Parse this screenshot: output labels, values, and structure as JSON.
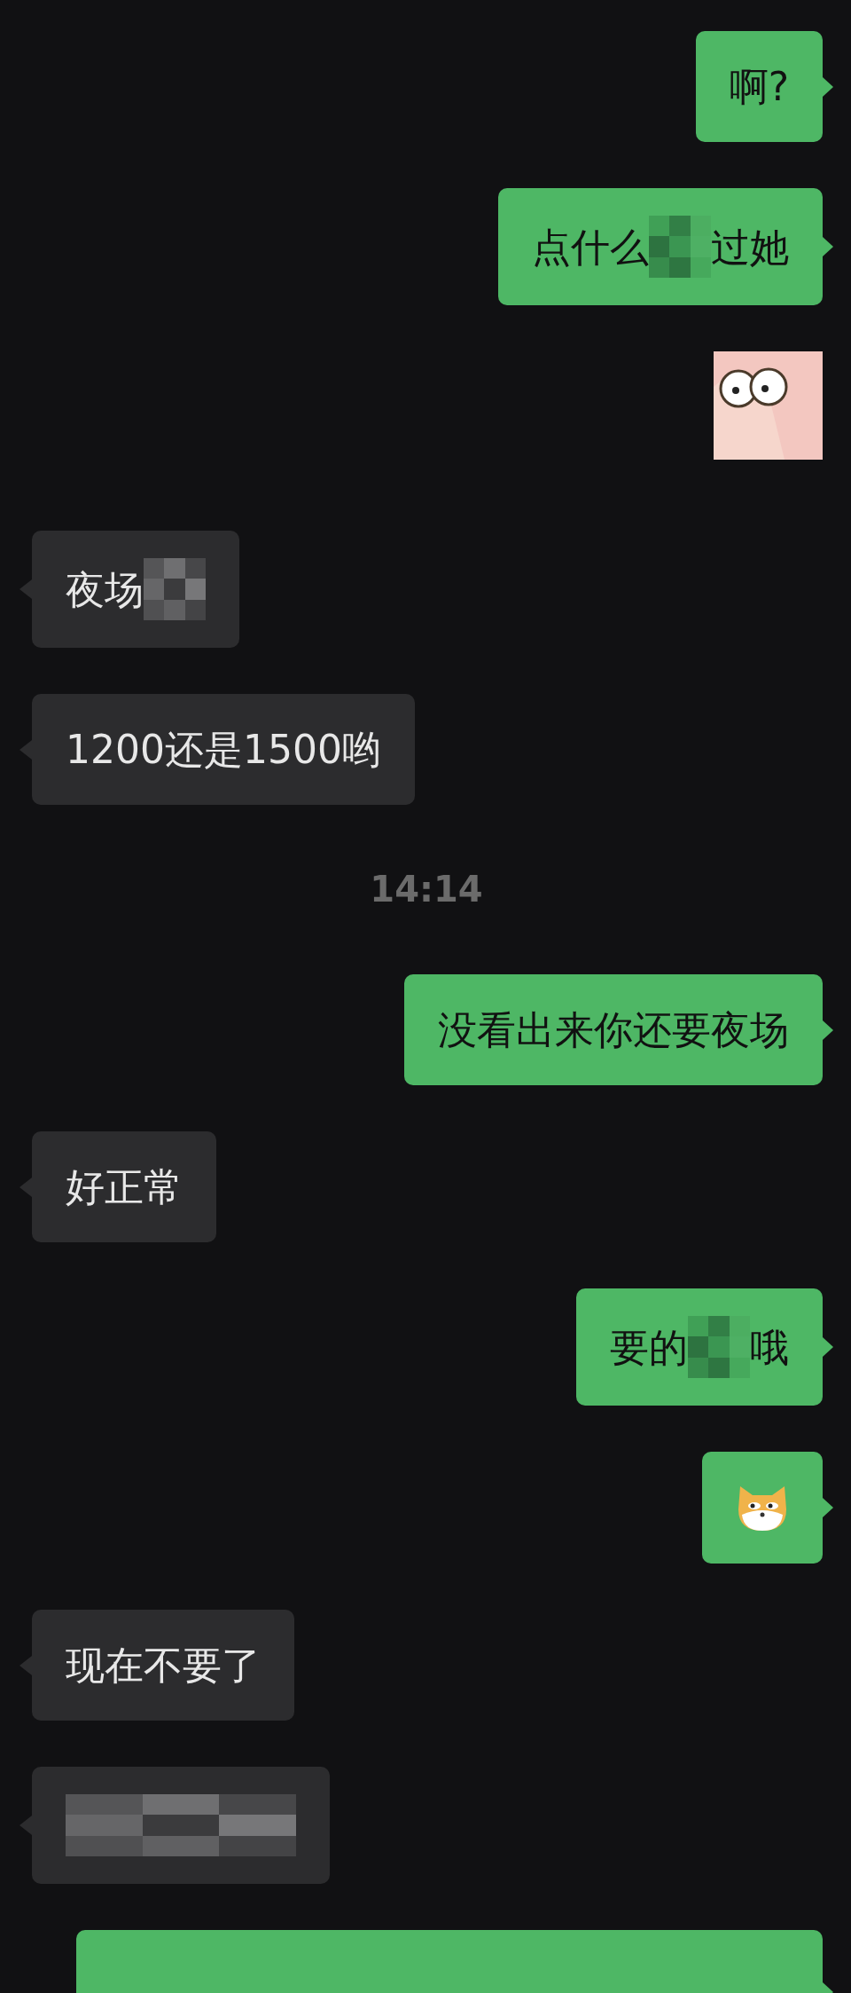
{
  "messages": [
    {
      "kind": "text",
      "outgoing": true,
      "segments": [
        {
          "kind": "text",
          "text": "啊?"
        }
      ]
    },
    {
      "kind": "text",
      "outgoing": true,
      "segments": [
        {
          "kind": "text",
          "text": "点什么"
        },
        {
          "kind": "mosaic"
        },
        {
          "kind": "text",
          "text": "过她"
        }
      ]
    },
    {
      "kind": "sticker",
      "outgoing": true
    },
    {
      "kind": "text",
      "outgoing": false,
      "segments": [
        {
          "kind": "text",
          "text": "夜场"
        },
        {
          "kind": "mosaic"
        }
      ]
    },
    {
      "kind": "text",
      "outgoing": false,
      "segments": [
        {
          "kind": "text",
          "text": "1200还是1500哟"
        }
      ]
    },
    {
      "kind": "time",
      "text": "14:14"
    },
    {
      "kind": "text",
      "outgoing": true,
      "segments": [
        {
          "kind": "text",
          "text": "没看出来你还要夜场"
        }
      ]
    },
    {
      "kind": "text",
      "outgoing": false,
      "segments": [
        {
          "kind": "text",
          "text": "好正常"
        }
      ]
    },
    {
      "kind": "text",
      "outgoing": true,
      "segments": [
        {
          "kind": "text",
          "text": "要的"
        },
        {
          "kind": "mosaic"
        },
        {
          "kind": "text",
          "text": "哦"
        }
      ]
    },
    {
      "kind": "emoji",
      "outgoing": true
    },
    {
      "kind": "text",
      "outgoing": false,
      "segments": [
        {
          "kind": "text",
          "text": "现在不要了"
        }
      ]
    },
    {
      "kind": "text",
      "outgoing": false,
      "segments": [
        {
          "kind": "mosaic"
        }
      ]
    },
    {
      "kind": "hidden",
      "outgoing": true
    }
  ]
}
